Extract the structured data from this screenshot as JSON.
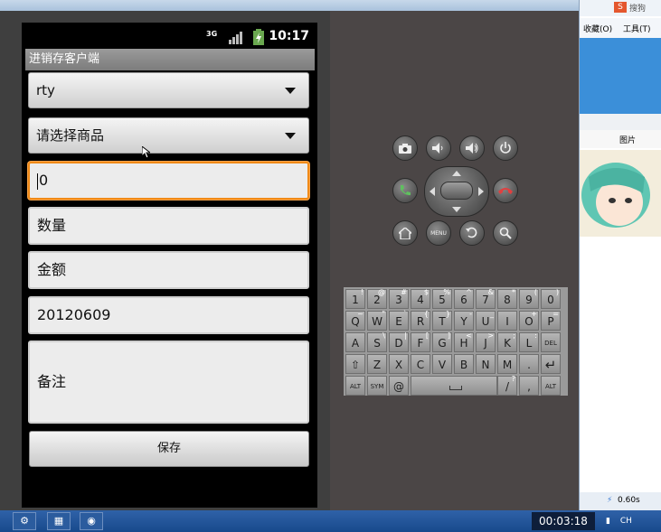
{
  "browser": {
    "menu_items": [
      "收藏(O)",
      "工具(T)"
    ],
    "search_label": "搜狗",
    "column_header": "图片",
    "status_text": "0.60s"
  },
  "app": {
    "title": "进销存客户端",
    "status_time": "10:17",
    "customer_spinner_value": "rty",
    "product_spinner_value": "请选择商品",
    "price_input_value": "0",
    "quantity_placeholder": "数量",
    "amount_placeholder": "金额",
    "date_value": "20120609",
    "remark_placeholder": "备注",
    "save_label": "保存"
  },
  "controls": {
    "row1": [
      "camera-icon",
      "volume-down-icon",
      "volume-up-icon",
      "power-icon"
    ],
    "row2": [
      "call-icon",
      "dpad",
      "end-call-icon"
    ],
    "row3": [
      "home-icon",
      "menu-label",
      "back-icon",
      "search-icon"
    ],
    "menu_label": "MENU"
  },
  "keyboard": {
    "row1": [
      [
        "1",
        "!"
      ],
      [
        "2",
        "@"
      ],
      [
        "3",
        "#"
      ],
      [
        "4",
        "$"
      ],
      [
        "5",
        "%"
      ],
      [
        "6",
        "^"
      ],
      [
        "7",
        "&"
      ],
      [
        "8",
        "*"
      ],
      [
        "9",
        "("
      ],
      [
        "0",
        ")"
      ]
    ],
    "row2": [
      [
        "Q",
        "~"
      ],
      [
        "W",
        "\""
      ],
      [
        "E",
        "`"
      ],
      [
        "R",
        "{"
      ],
      [
        "T",
        "}"
      ],
      [
        "Y",
        "-"
      ],
      [
        "U",
        "_"
      ],
      [
        "I",
        ""
      ],
      [
        "O",
        "+"
      ],
      [
        "P",
        "="
      ]
    ],
    "row3": [
      [
        "A",
        ""
      ],
      [
        "S",
        "\\"
      ],
      [
        "D",
        "|"
      ],
      [
        "F",
        "["
      ],
      [
        "G",
        "]"
      ],
      [
        "H",
        "<"
      ],
      [
        "J",
        ">"
      ],
      [
        "K",
        ";"
      ],
      [
        "L",
        ":"
      ],
      [
        "DEL",
        ""
      ]
    ],
    "row4": [
      [
        "⇧",
        ""
      ],
      [
        "Z",
        ""
      ],
      [
        "X",
        ""
      ],
      [
        "C",
        ""
      ],
      [
        "V",
        ""
      ],
      [
        "B",
        ""
      ],
      [
        "N",
        ""
      ],
      [
        "M",
        ""
      ],
      [
        ".",
        ""
      ],
      [
        "↵",
        ""
      ]
    ],
    "row5_left": [
      "ALT",
      "SYM",
      "@"
    ],
    "row5_right": [
      "/",
      "?",
      ",",
      "ALT"
    ]
  },
  "taskbar": {
    "clock": "00:03:18",
    "tray_text": "CH"
  },
  "colors": {
    "focus": "#f08a18",
    "taskbar": "#1e5296",
    "emulator_skin": "#4b4646"
  }
}
